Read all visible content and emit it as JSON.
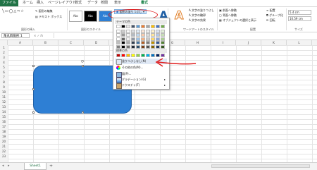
{
  "tabs": [
    "ファイル",
    "ホーム",
    "挿入",
    "ページレイアウト",
    "数式",
    "データ",
    "校閲",
    "表示",
    "書式"
  ],
  "ribbon": {
    "insert_shapes_label": "図形の挿入",
    "edit_shape": "図形の編集",
    "text_box": "テキスト ボックス",
    "style_swatch_label": "Abc",
    "shape_styles_label": "図形のスタイル",
    "fill_button": "図形の塗りつぶし",
    "wordart_label": "ワードアートのスタイル",
    "wordart_letter": "A",
    "text_fill": "文字の塗りつぶし",
    "text_outline": "文字の輪郭",
    "text_effects": "文字の効果",
    "bring_forward": "前面へ移動",
    "send_backward": "背面へ移動",
    "selection_pane": "オブジェクトの選択と表示",
    "align": "配置",
    "group": "グループ化",
    "rotate": "回転",
    "arrange_label": "配置",
    "height_value": "5.4 cm",
    "width_value": "10.59 cm",
    "size_label": "サイズ"
  },
  "formula_bar": {
    "name_box": "角丸四角形 1",
    "fx": "fx"
  },
  "columns": [
    "A",
    "B",
    "C",
    "D",
    "E",
    "F",
    "G",
    "H",
    "I",
    "J",
    "K",
    "L"
  ],
  "rows": [
    "1",
    "2",
    "3",
    "4",
    "5",
    "6",
    "7",
    "8",
    "9",
    "10",
    "11",
    "12",
    "13",
    "14",
    "15",
    "16",
    "17",
    "18",
    "19",
    "20",
    "21",
    "22",
    "23"
  ],
  "sheet_tab": "Sheet1",
  "add_sheet": "+",
  "dropdown": {
    "theme_colors_label": "テーマの色",
    "standard_colors_label": "標準の色",
    "no_fill": "塗りつぶしなし(N)",
    "other_colors": "その他の色(M)...",
    "picture": "図(P)...",
    "gradient": "グラデーション(G)",
    "texture": "テクスチャ(T)"
  },
  "colors": {
    "accent": "#217346",
    "shape_fill": "#2E7FD4",
    "annotation": "#E01C1C",
    "theme_row": [
      "#FFFFFF",
      "#000000",
      "#E7E6E6",
      "#44546A",
      "#5B9BD5",
      "#ED7D31",
      "#A5A5A5",
      "#FFC000",
      "#4472C4",
      "#70AD47"
    ],
    "standard_row": [
      "#C00000",
      "#FF0000",
      "#FFC000",
      "#FFFF00",
      "#92D050",
      "#00B050",
      "#00B0F0",
      "#0070C0",
      "#002060",
      "#7030A0"
    ]
  }
}
